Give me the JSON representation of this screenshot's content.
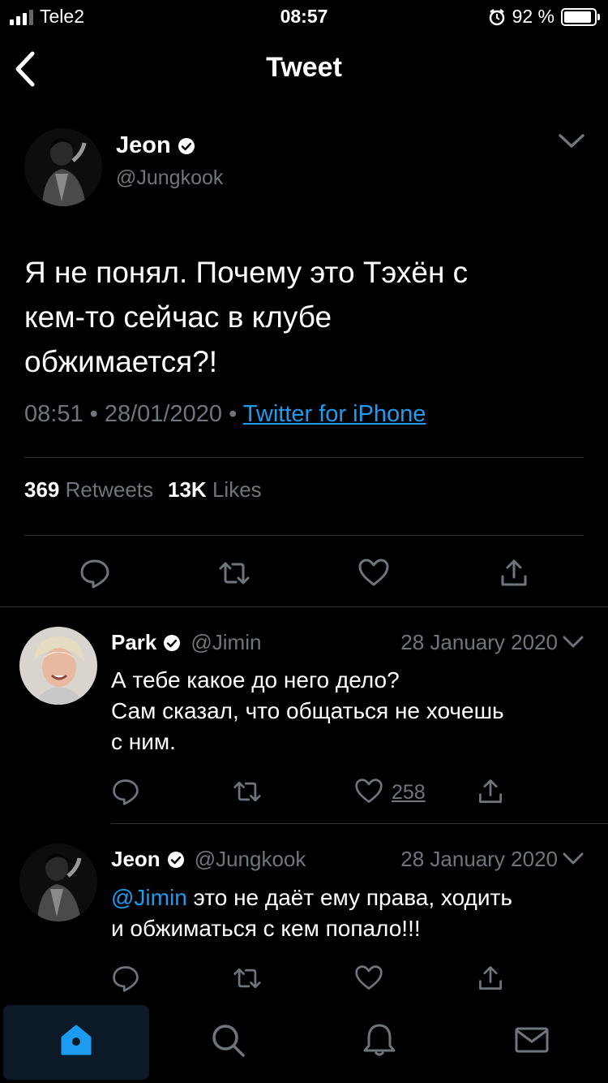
{
  "status_bar": {
    "carrier": "Tele2",
    "time": "08:57",
    "battery": "92 %",
    "battery_level": 0.92
  },
  "nav": {
    "title": "Tweet",
    "back_icon": "chevron-left-icon"
  },
  "tweet": {
    "name": "Jeon",
    "handle": "@Jungkook",
    "text_lines": [
      "Я не понял. Почему это Тэхён с",
      "кем-то сейчас в клубе",
      "обжимается?!"
    ],
    "time": "08:51",
    "date": "28/01/2020",
    "source": "Twitter for iPhone",
    "retweets_count": "369",
    "retweets_label": "Retweets",
    "likes_count": "13K",
    "likes_label": "Likes"
  },
  "replies": [
    {
      "name": "Park",
      "handle": "@Jimin",
      "date": "28 January 2020",
      "text_lines": [
        "А тебе какое до него дело?",
        "Сам сказал, что общаться не хочешь",
        "с ним."
      ],
      "like_count": "258"
    },
    {
      "name": "Jeon",
      "handle": "@Jungkook",
      "date": "28 January 2020",
      "mention": "@Jimin",
      "text_lines": [
        " это не даёт ему права, ходить",
        "и обжиматься с кем попало!!!"
      ]
    }
  ],
  "tabbar": {
    "items": [
      "home-icon",
      "search-icon",
      "notifications-icon",
      "messages-icon"
    ],
    "active": "home-icon"
  },
  "colors": {
    "accent": "#1d9bf0",
    "muted": "#6e767d",
    "background": "#000000"
  }
}
